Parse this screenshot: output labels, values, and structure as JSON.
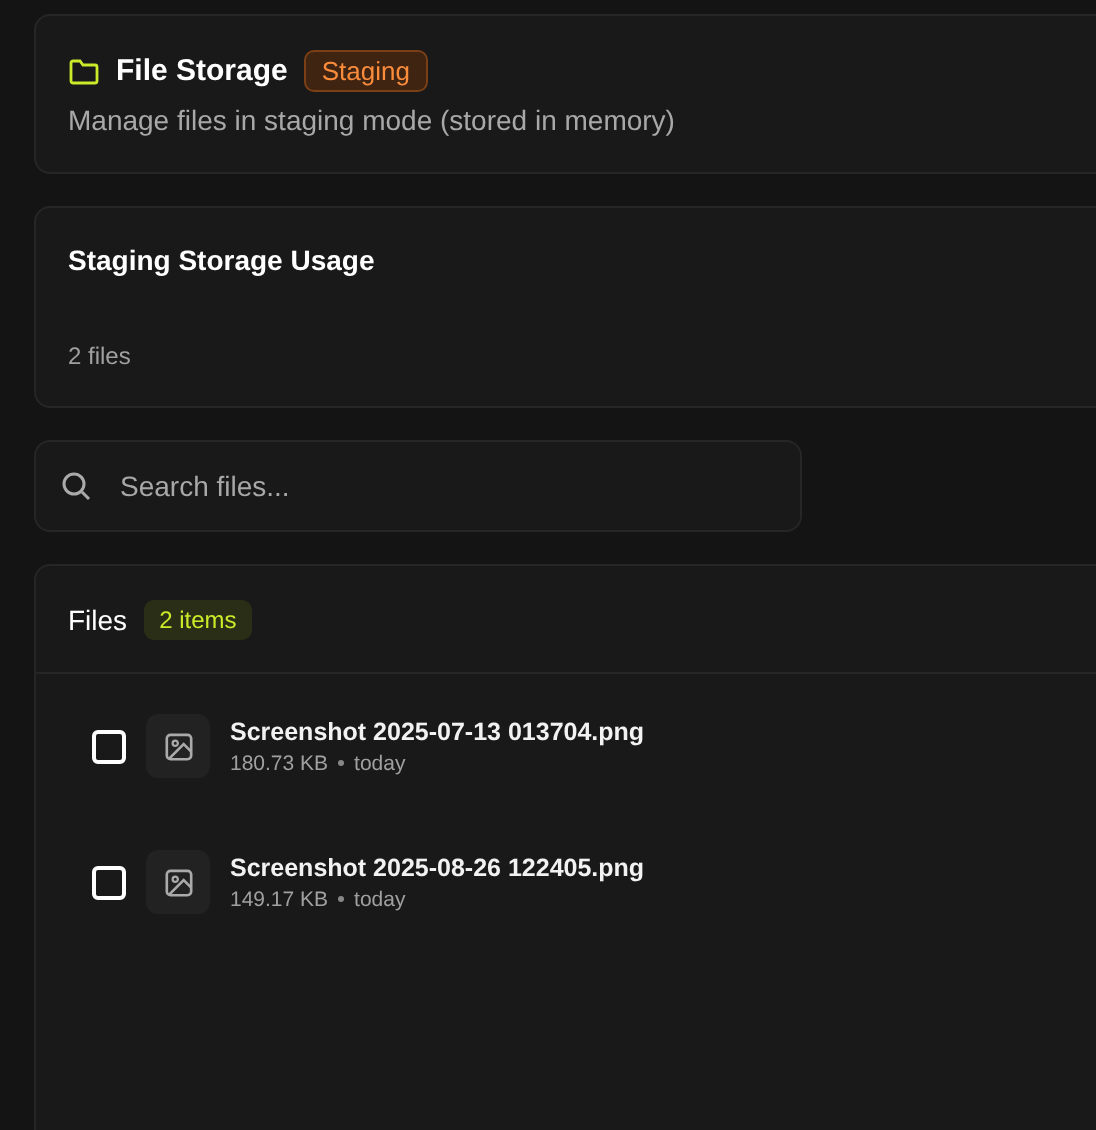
{
  "header": {
    "title": "File Storage",
    "badge": "Staging",
    "description": "Manage files in staging mode (stored in memory)"
  },
  "usage": {
    "title": "Staging Storage Usage",
    "count": "2 files"
  },
  "search": {
    "placeholder": "Search files..."
  },
  "files": {
    "title": "Files",
    "count": "2 items",
    "items": [
      {
        "name": "Screenshot 2025-07-13 013704.png",
        "size": "180.73 KB",
        "date": "today",
        "checked": false
      },
      {
        "name": "Screenshot 2025-08-26 122405.png",
        "size": "149.17 KB",
        "date": "today",
        "checked": false
      }
    ]
  }
}
